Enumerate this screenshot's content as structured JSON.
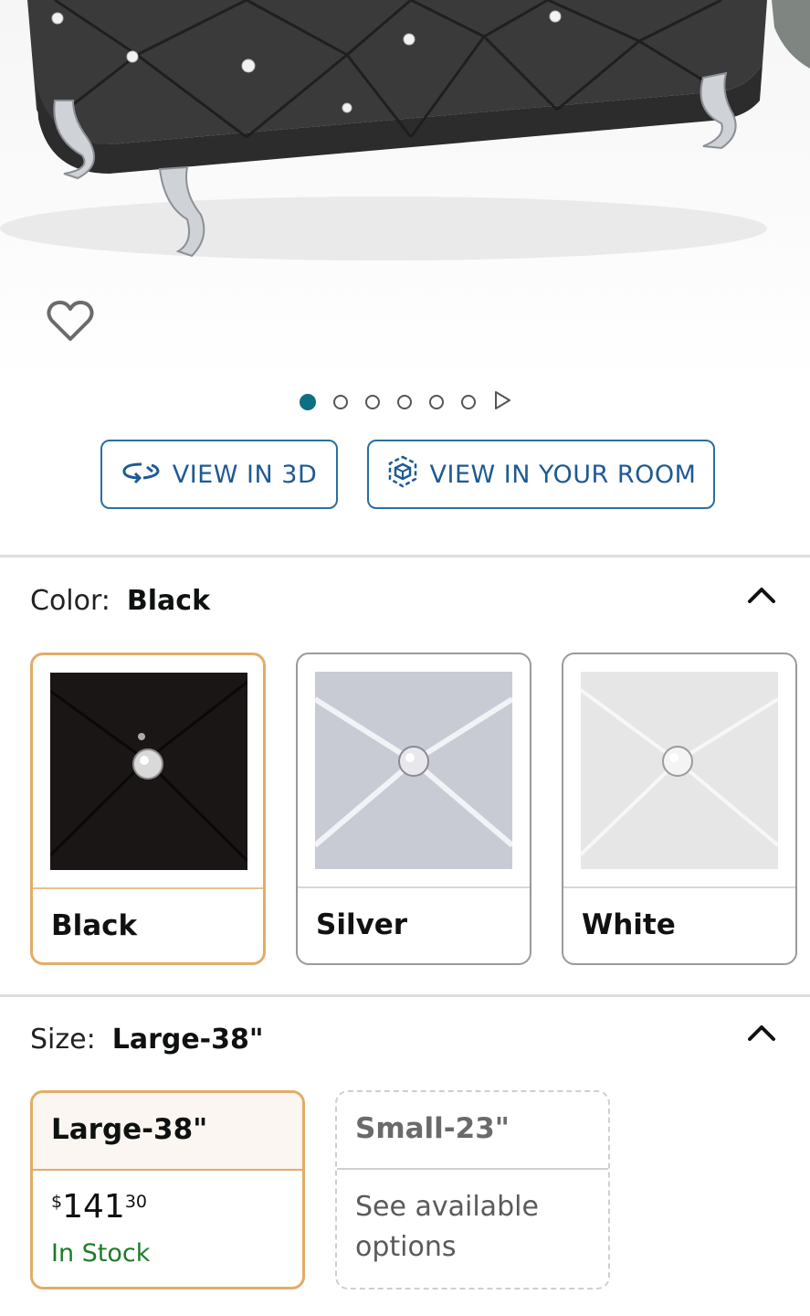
{
  "carousel": {
    "total_dots": 6,
    "active_index": 0
  },
  "buttons": {
    "view_3d": "VIEW IN 3D",
    "view_room": "VIEW IN YOUR ROOM"
  },
  "color": {
    "label": "Color:",
    "selected": "Black",
    "options": [
      {
        "name": "Black",
        "swatch_color": "#1b1616"
      },
      {
        "name": "Silver",
        "swatch_color": "#c9cbd4"
      },
      {
        "name": "White",
        "swatch_color": "#e6e6e6"
      }
    ]
  },
  "size": {
    "label": "Size:",
    "selected": "Large-38\"",
    "options": [
      {
        "name": "Large-38\"",
        "price_symbol": "$",
        "price_whole": "141",
        "price_cents": "30",
        "stock": "In Stock"
      },
      {
        "name": "Small-23\"",
        "availability": "See available options"
      }
    ]
  },
  "colors": {
    "accent_selected": "#e2ac68",
    "link_blue": "#1d5a94",
    "in_stock_green": "#1d7c2a",
    "carousel_active": "#0e6e82"
  },
  "icons": {
    "wishlist": "heart-outline-icon",
    "view3d": "rotate-3d-icon",
    "viewroom": "ar-cube-icon",
    "collapse": "chevron-up-icon",
    "carousel_next": "play-triangle-icon"
  }
}
